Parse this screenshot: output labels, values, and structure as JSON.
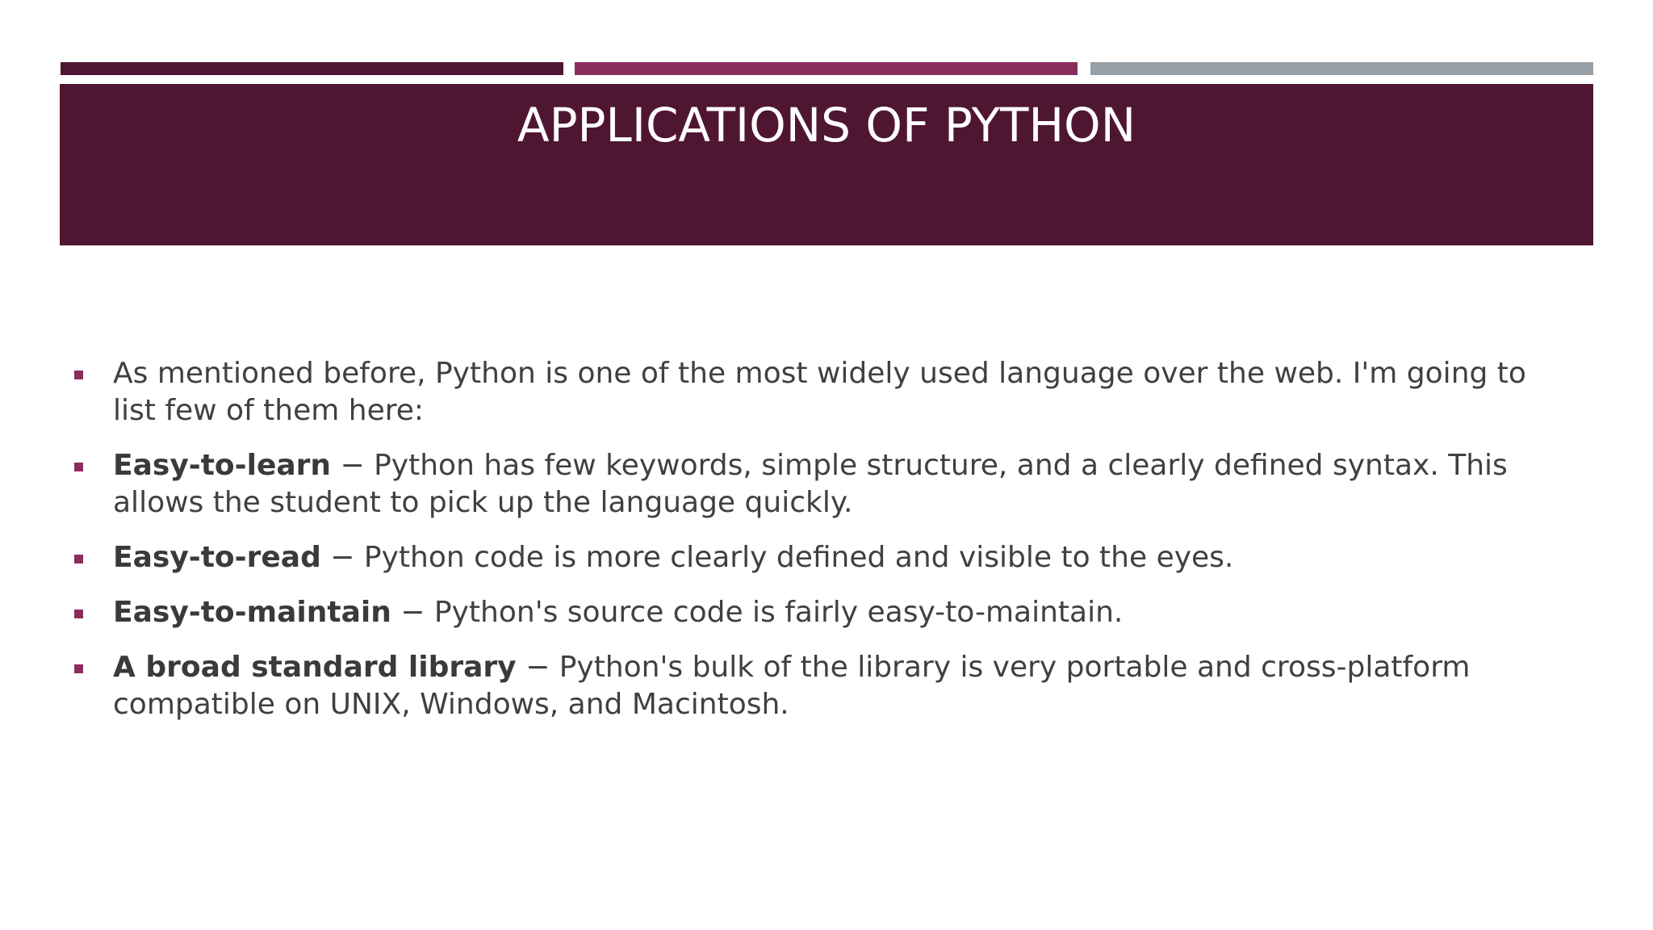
{
  "slide": {
    "title": "APPLICATIONS OF PYTHON",
    "bullets": [
      {
        "term": "",
        "text": "As mentioned before, Python is one of the most widely used language over the web. I'm going to list few of them here:"
      },
      {
        "term": "Easy-to-learn",
        "text": " − Python has few keywords, simple structure, and a clearly defined syntax. This allows the student to pick up the language quickly."
      },
      {
        "term": "Easy-to-read",
        "text": " − Python code is more clearly defined and visible to the eyes."
      },
      {
        "term": "Easy-to-maintain",
        "text": " − Python's source code is fairly easy-to-maintain."
      },
      {
        "term": "A broad standard library",
        "text": " − Python's bulk of the library is very portable and cross-platform compatible on UNIX, Windows, and Macintosh."
      }
    ]
  },
  "colors": {
    "title_bar": "#4f1632",
    "stripe_1": "#4f1632",
    "stripe_2": "#8b2c5e",
    "stripe_3": "#97a0a7",
    "bullet": "#8b2c5e",
    "body_text": "#404040"
  }
}
